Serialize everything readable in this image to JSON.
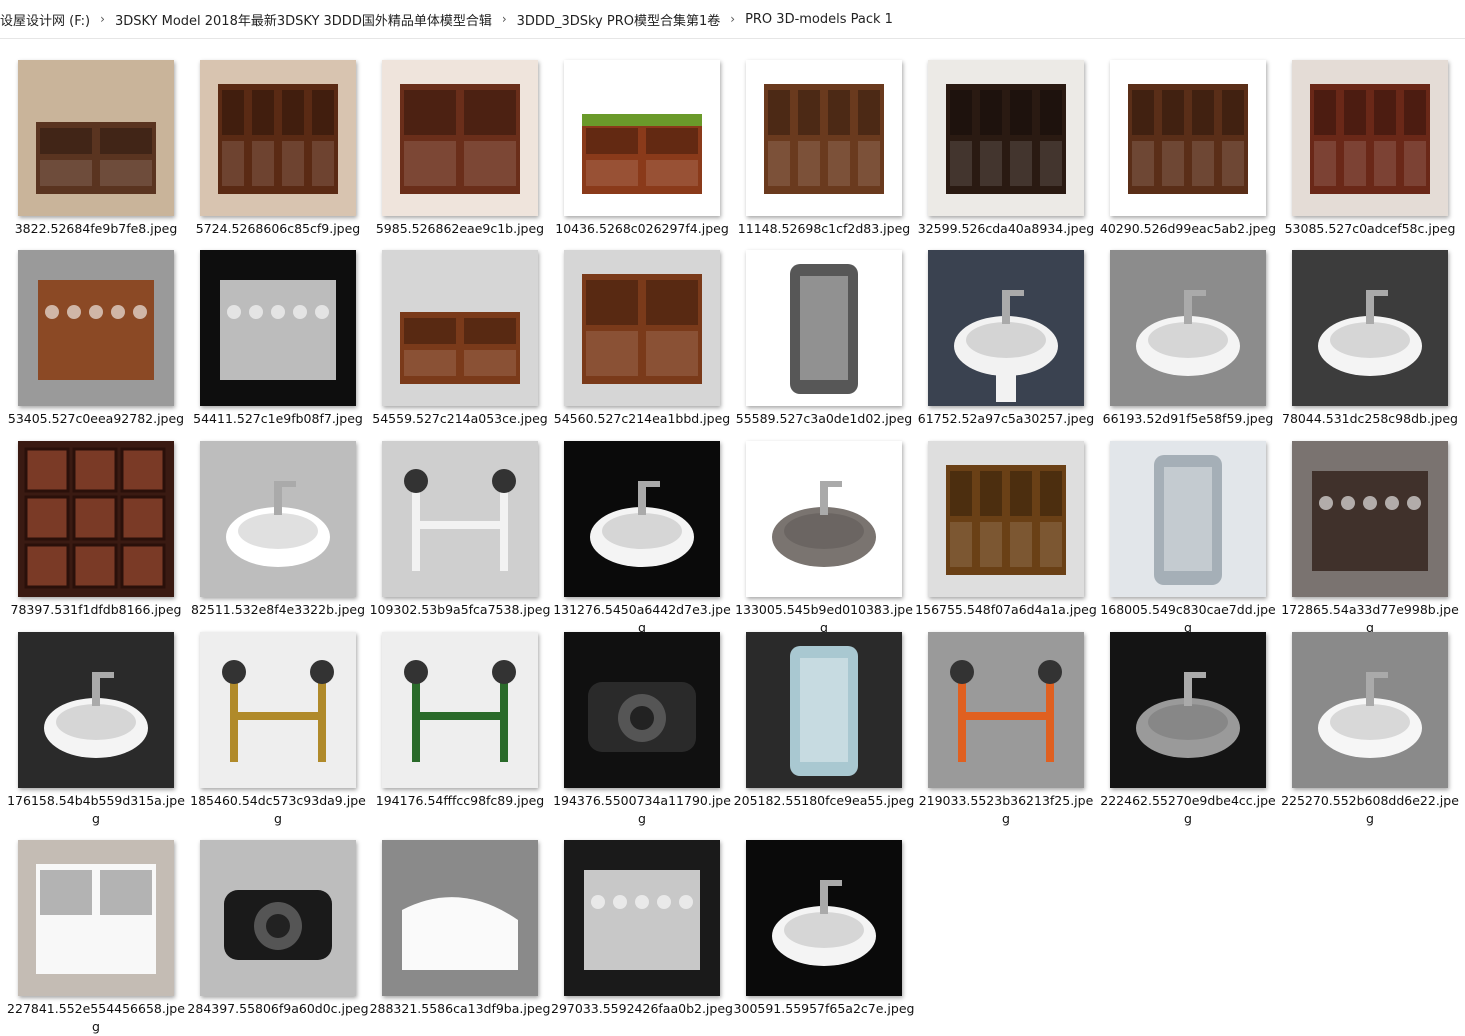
{
  "breadcrumb": [
    "设屋设计网 (F:)",
    "3DSKY Model 2018年最新3DSKY 3DDD国外精品单体模型合辑",
    "3DDD_3DSky PRO模型合集第1卷",
    "PRO 3D-models Pack 1"
  ],
  "files": [
    {
      "name": "3822.52684fe9b7fe8.jpeg",
      "icon": "desk-thumbnail",
      "bg": "#c9b49a",
      "fg": "#5a3420",
      "dark": false
    },
    {
      "name": "5724.5268606c85cf9.jpeg",
      "icon": "bookcase-thumbnail",
      "bg": "#d8c4b0",
      "fg": "#5a2a14",
      "dark": false
    },
    {
      "name": "5985.526862eae9c1b.jpeg",
      "icon": "tv-cabinet-thumbnail",
      "bg": "#efe4dc",
      "fg": "#6a2e1a",
      "dark": false
    },
    {
      "name": "10436.5268c026297f4.jpeg",
      "icon": "billiard-desk-thumbnail",
      "bg": "#ffffff",
      "fg": "#8a3a1a",
      "dark": false
    },
    {
      "name": "11148.52698c1cf2d83.jpeg",
      "icon": "shelving-unit-thumbnail",
      "bg": "#ffffff",
      "fg": "#6a3a1e",
      "dark": false
    },
    {
      "name": "32599.526cda40a8934.jpeg",
      "icon": "library-cabinet-thumbnail",
      "bg": "#eceae6",
      "fg": "#2a1a12",
      "dark": false
    },
    {
      "name": "40290.526d99eac5ab2.jpeg",
      "icon": "office-bookcase-thumbnail",
      "bg": "#ffffff",
      "fg": "#5a2e18",
      "dark": false
    },
    {
      "name": "53085.527c0adcef58c.jpeg",
      "icon": "wall-library-thumbnail",
      "bg": "#e4dcd6",
      "fg": "#6a2818",
      "dark": false
    },
    {
      "name": "53405.527c0eea92782.jpeg",
      "icon": "display-cabinet-thumbnail",
      "bg": "#9a9a9a",
      "fg": "#8a4018",
      "dark": false
    },
    {
      "name": "54411.527c1e9fb08f7.jpeg",
      "icon": "bath-accessories-thumbnail",
      "bg": "#0e0e0e",
      "fg": "#cfcfcf",
      "dark": true
    },
    {
      "name": "54559.527c214a053ce.jpeg",
      "icon": "writing-desk-thumbnail",
      "bg": "#d6d6d6",
      "fg": "#7a3a1a",
      "dark": false
    },
    {
      "name": "54560.527c214ea1bbd.jpeg",
      "icon": "low-cabinet-thumbnail",
      "bg": "#d6d6d6",
      "fg": "#7a3a1a",
      "dark": false
    },
    {
      "name": "55589.527c3a0de1d02.jpeg",
      "icon": "shower-cabin-thumbnail",
      "bg": "#ffffff",
      "fg": "#3a3a3a",
      "dark": false
    },
    {
      "name": "61752.52a97c5a30257.jpeg",
      "icon": "pedestal-sink-thumbnail",
      "bg": "#3a4250",
      "fg": "#f2f2f2",
      "dark": true
    },
    {
      "name": "66193.52d91f5e58f59.jpeg",
      "icon": "vessel-sink-thumbnail",
      "bg": "#8c8c8c",
      "fg": "#f4f4f4",
      "dark": false
    },
    {
      "name": "78044.531dc258c98db.jpeg",
      "icon": "corner-sink-thumbnail",
      "bg": "#3c3c3c",
      "fg": "#f4f4f4",
      "dark": true
    },
    {
      "name": "78397.531f1dfdb8166.jpeg",
      "icon": "ceiling-panel-thumbnail",
      "bg": "#3a1a12",
      "fg": "#7a3a26",
      "dark": true
    },
    {
      "name": "82511.532e8f4e3322b.jpeg",
      "icon": "mosaic-sink-thumbnail",
      "bg": "#bdbdbd",
      "fg": "#ffffff",
      "dark": false
    },
    {
      "name": "109302.53b9a5fca7538.jpeg",
      "icon": "weight-bench-thumbnail",
      "bg": "#cfcfcf",
      "fg": "#f2f2f2",
      "dark": false
    },
    {
      "name": "131276.5450a6442d7e3.jpeg",
      "icon": "freestanding-basin-thumbnail",
      "bg": "#0a0a0a",
      "fg": "#f4f4f4",
      "dark": true
    },
    {
      "name": "133005.545b9ed010383.jpeg",
      "icon": "round-sink-thumbnail",
      "bg": "#ffffff",
      "fg": "#7a7470",
      "dark": false
    },
    {
      "name": "156755.548f07a6d4a1a.jpeg",
      "icon": "wooden-wardrobe-thumbnail",
      "bg": "#dedede",
      "fg": "#6a4016",
      "dark": false
    },
    {
      "name": "168005.549c830cae7dd.jpeg",
      "icon": "glass-shower-thumbnail",
      "bg": "#e2e6ea",
      "fg": "#9aa4ae",
      "dark": false
    },
    {
      "name": "172865.54a33d77e998b.jpeg",
      "icon": "double-vanity-thumbnail",
      "bg": "#7a7370",
      "fg": "#3a2a24",
      "dark": false
    },
    {
      "name": "176158.54b4b559d315a.jpeg",
      "icon": "oval-washbasin-thumbnail",
      "bg": "#2a2a2a",
      "fg": "#f4f4f4",
      "dark": true
    },
    {
      "name": "185460.54dc573c93da9.jpeg",
      "icon": "trophies-thumbnail",
      "bg": "#eeeeee",
      "fg": "#b08a2a",
      "dark": false
    },
    {
      "name": "194176.54fffcc98fc89.jpeg",
      "icon": "climbing-frame-thumbnail",
      "bg": "#eeeeee",
      "fg": "#2a6a2a",
      "dark": false
    },
    {
      "name": "194376.5500734a11790.jpeg",
      "icon": "projector-thumbnail",
      "bg": "#101010",
      "fg": "#2a2a2a",
      "dark": true
    },
    {
      "name": "205182.55180fce9ea55.jpeg",
      "icon": "steam-shower-thumbnail",
      "bg": "#2a2a2a",
      "fg": "#bfe4ef",
      "dark": true
    },
    {
      "name": "219033.5523b36213f25.jpeg",
      "icon": "preacher-bench-thumbnail",
      "bg": "#9a9a9a",
      "fg": "#e06020",
      "dark": false
    },
    {
      "name": "222462.55270e9dbe4cc.jpeg",
      "icon": "silver-bowl-sink-thumbnail",
      "bg": "#141414",
      "fg": "#9a9a9a",
      "dark": true
    },
    {
      "name": "225270.552b608dd6e22.jpeg",
      "icon": "boat-basin-thumbnail",
      "bg": "#8a8a8a",
      "fg": "#f6f6f6",
      "dark": false
    },
    {
      "name": "227841.552e554456658.jpeg",
      "icon": "vanity-unit-thumbnail",
      "bg": "#c4bcb4",
      "fg": "#f8f8f8",
      "dark": false
    },
    {
      "name": "284397.55806f9a60d0c.jpeg",
      "icon": "camera-thumbnail",
      "bg": "#bdbdbd",
      "fg": "#1a1a1a",
      "dark": false
    },
    {
      "name": "288321.5586ca13df9ba.jpeg",
      "icon": "corner-bathtub-thumbnail",
      "bg": "#8a8a8a",
      "fg": "#fafafa",
      "dark": false
    },
    {
      "name": "297033.5592426faa0b2.jpeg",
      "icon": "bathroom-accessories-thumbnail",
      "bg": "#1a1a1a",
      "fg": "#dcdcdc",
      "dark": true
    },
    {
      "name": "300591.55957f65a2c7e.jpeg",
      "icon": "wall-basin-thumbnail",
      "bg": "#0a0a0a",
      "fg": "#f4f4f4",
      "dark": true
    }
  ]
}
